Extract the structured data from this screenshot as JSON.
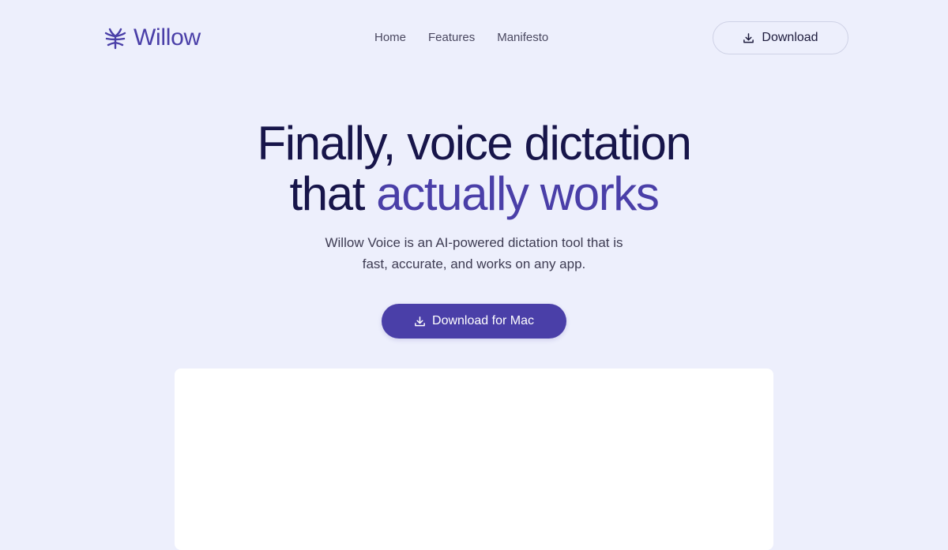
{
  "brand": {
    "name": "Willow",
    "logo_icon": "willow-leaf-icon",
    "accent_color": "#4a3fa8",
    "background_color": "#edeffc"
  },
  "nav": {
    "links": [
      {
        "label": "Home"
      },
      {
        "label": "Features"
      },
      {
        "label": "Manifesto"
      }
    ],
    "download_label": "Download",
    "download_icon": "download-icon"
  },
  "hero": {
    "title_line1": "Finally, voice dictation",
    "title_line2_plain": "that ",
    "title_line2_accent": "actually works",
    "subtitle_line1": "Willow Voice is an AI-powered dictation tool that is",
    "subtitle_line2": "fast, accurate, and works on any app.",
    "cta_label": "Download for Mac",
    "cta_icon": "download-icon"
  }
}
